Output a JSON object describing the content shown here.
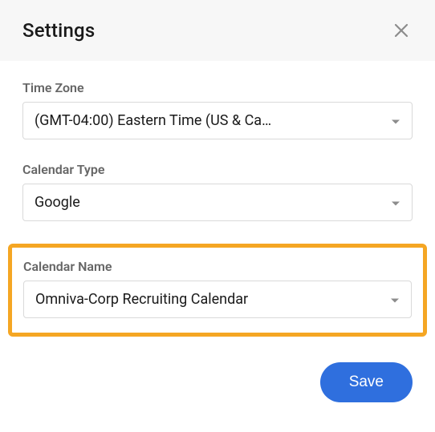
{
  "header": {
    "title": "Settings"
  },
  "fields": {
    "time_zone": {
      "label": "Time Zone",
      "value": "(GMT-04:00) Eastern Time (US & Ca…"
    },
    "calendar_type": {
      "label": "Calendar Type",
      "value": "Google"
    },
    "calendar_name": {
      "label": "Calendar Name",
      "value": "Omniva-Corp Recruiting Calendar"
    }
  },
  "footer": {
    "save_label": "Save"
  },
  "colors": {
    "highlight": "#f5a623",
    "primary": "#2f6fde"
  }
}
